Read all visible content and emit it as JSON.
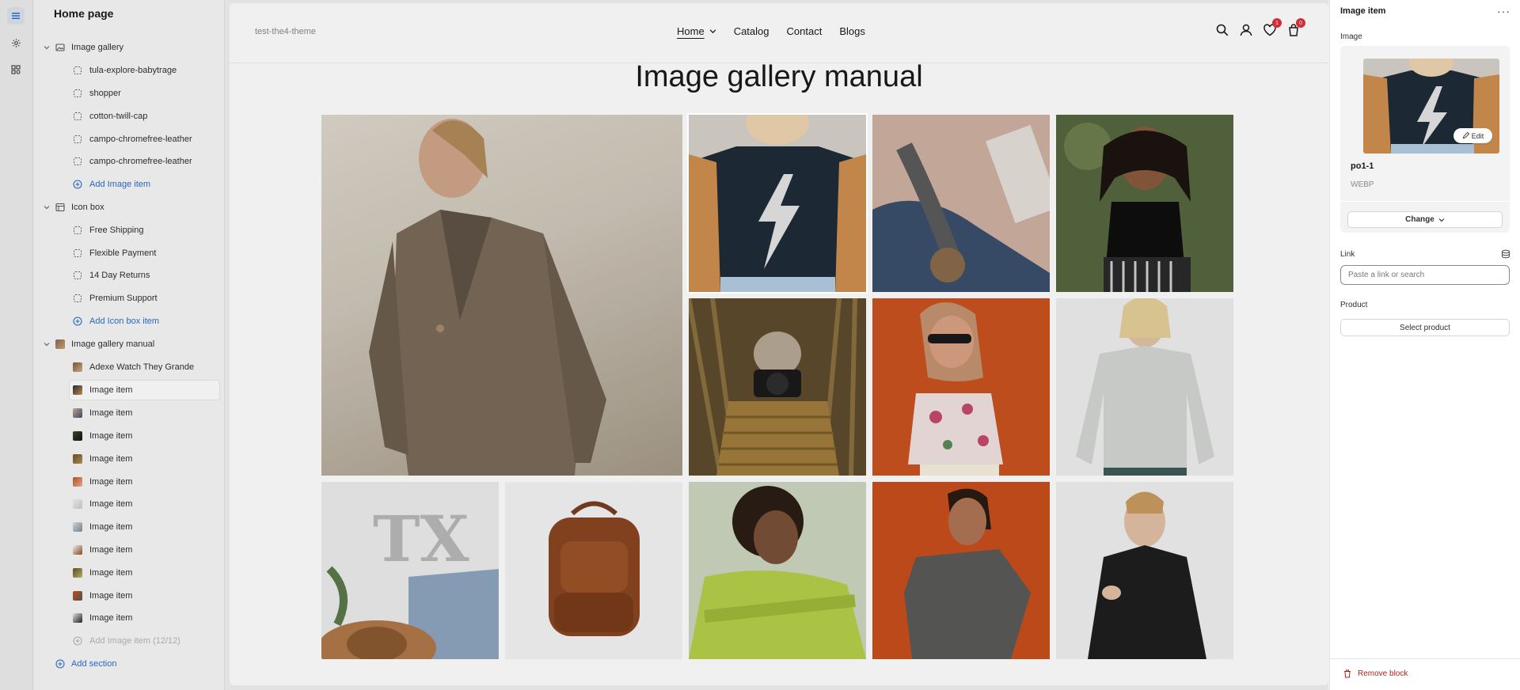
{
  "sidebar": {
    "title": "Home page",
    "sections": [
      {
        "label": "Image gallery",
        "blocks": [
          "tula-explore-babytrage",
          "shopper",
          "cotton-twill-cap",
          "campo-chromefree-leather",
          "campo-chromefree-leather"
        ],
        "add_label": "Add Image item"
      },
      {
        "label": "Icon box",
        "blocks": [
          "Free Shipping",
          "Flexible Payment",
          "14 Day Returns",
          "Premium Support"
        ],
        "add_label": "Add Icon box item"
      },
      {
        "label": "Image gallery manual",
        "blocks": [
          "Adexe Watch They Grande",
          "Image item",
          "Image item",
          "Image item",
          "Image item",
          "Image item",
          "Image item",
          "Image item",
          "Image item",
          "Image item",
          "Image item",
          "Image item"
        ],
        "add_label": "Add Image item (12/12)"
      }
    ],
    "add_section_label": "Add section"
  },
  "preview": {
    "store_name": "test-the4-theme",
    "nav": [
      "Home",
      "Catalog",
      "Contact",
      "Blogs"
    ],
    "wishlist_count": "1",
    "cart_count": "0",
    "gallery_title": "Image gallery manual"
  },
  "panel": {
    "title": "Image item",
    "more_icon": "more-horizontal-icon",
    "image_label": "Image",
    "edit_label": "Edit",
    "image_name": "po1-1",
    "image_format": "WEBP",
    "change_label": "Change",
    "link_label": "Link",
    "link_placeholder": "Paste a link or search",
    "product_label": "Product",
    "select_product_label": "Select product",
    "remove_label": "Remove block"
  },
  "colors": {
    "accent": "#2c6ecb",
    "danger": "#b42318",
    "badge": "#e0303a"
  }
}
